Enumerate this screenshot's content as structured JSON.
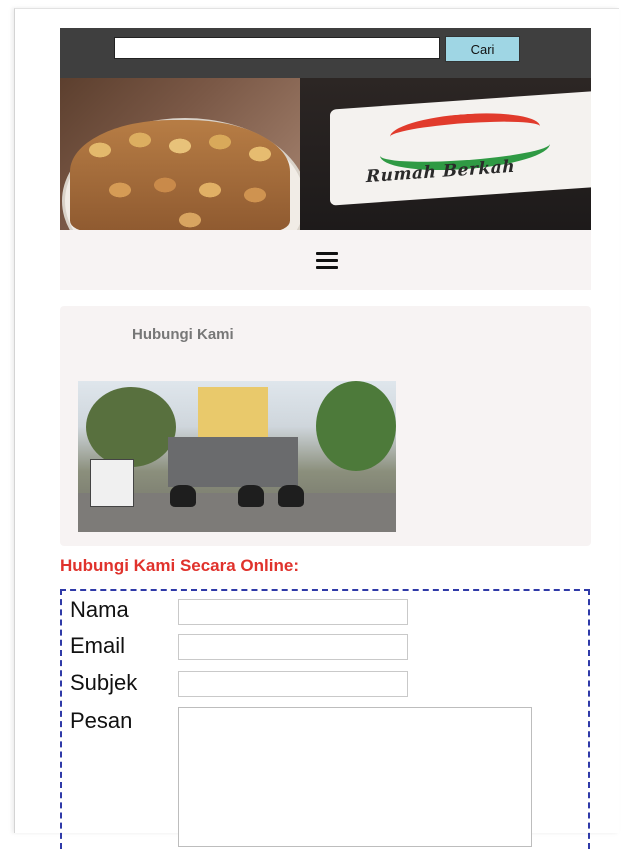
{
  "search": {
    "value": "",
    "button_label": "Cari"
  },
  "banner": {
    "sign_text": "Rumah Berkah"
  },
  "menu": {
    "icon": "hamburger-menu-icon"
  },
  "page": {
    "heading": "Hubungi Kami"
  },
  "contact": {
    "heading": "Hubungi Kami Secara Online:",
    "heading_color": "#e0322c",
    "fields": {
      "name_label": "Nama",
      "email_label": "Email",
      "subject_label": "Subjek",
      "message_label": "Pesan"
    }
  }
}
